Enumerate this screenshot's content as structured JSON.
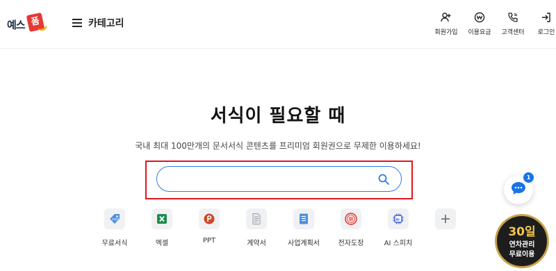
{
  "logo": {
    "text": "예스",
    "tag": "폼"
  },
  "header": {
    "category_label": "카테고리",
    "nav": [
      {
        "label": "회원가입",
        "icon": "add-user-icon"
      },
      {
        "label": "이용요금",
        "icon": "won-icon"
      },
      {
        "label": "고객센터",
        "icon": "phone-icon"
      },
      {
        "label": "로그인",
        "icon": "login-icon"
      }
    ]
  },
  "hero": {
    "title": "서식이 필요할 때",
    "subtitle": "국내 최대 100만개의 문서서식 콘텐츠를 프리미엄 회원권으로 무제한 이용하세요!"
  },
  "search": {
    "value": "",
    "placeholder": ""
  },
  "categories": [
    {
      "label": "무료서식",
      "icon": "free-tag-icon",
      "color": "#4a90e2"
    },
    {
      "label": "엑셀",
      "icon": "excel-icon",
      "color": "#1e8c4e"
    },
    {
      "label": "PPT",
      "icon": "ppt-icon",
      "color": "#d24726"
    },
    {
      "label": "계약서",
      "icon": "contract-icon",
      "color": "#9aa0a6"
    },
    {
      "label": "사업계획서",
      "icon": "business-plan-icon",
      "color": "#4a90e2"
    },
    {
      "label": "전자도장",
      "icon": "stamp-icon",
      "color": "#d93025"
    },
    {
      "label": "AI 스피치",
      "icon": "ai-chip-icon",
      "color": "#3b5bdb"
    },
    {
      "label": "",
      "icon": "plus-icon",
      "color": "#666666"
    }
  ],
  "chat": {
    "badge": "1"
  },
  "promo": {
    "big": "30일",
    "line1": "연차관리",
    "line2": "무료이용"
  },
  "colors": {
    "accent": "#2b7de1",
    "highlight": "#e0141b"
  }
}
